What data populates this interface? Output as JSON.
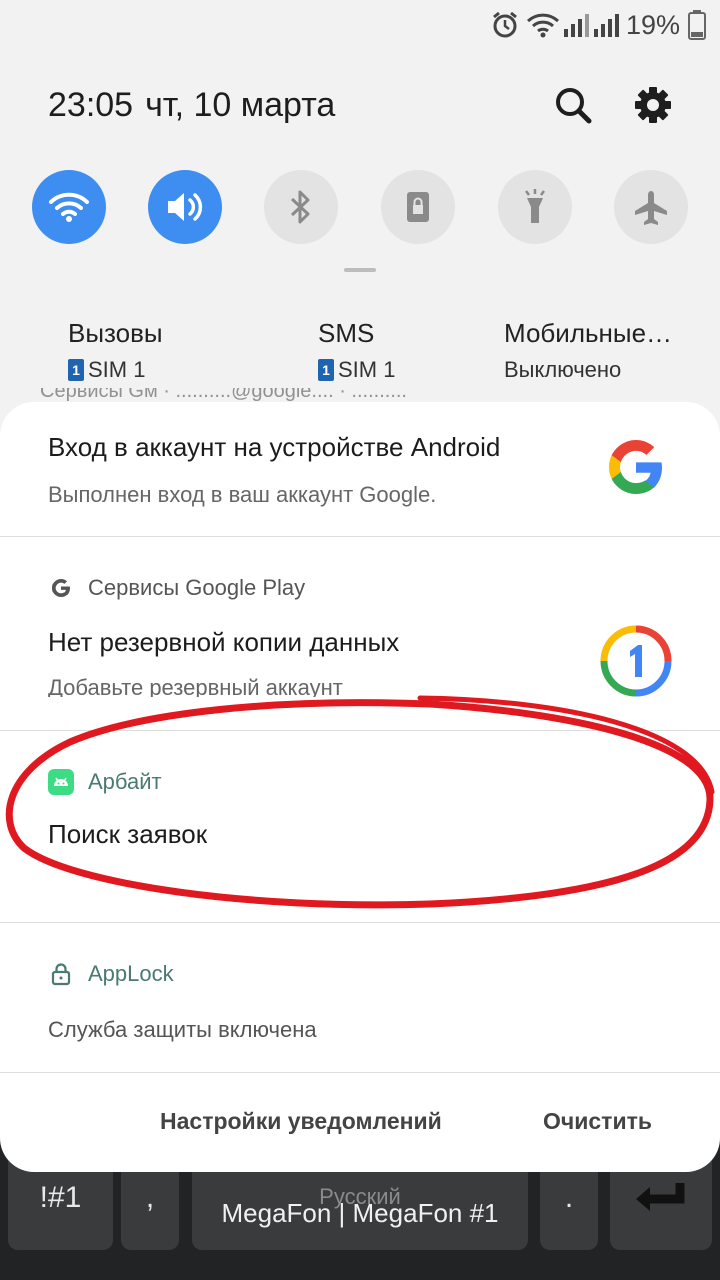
{
  "status_bar": {
    "battery_percent": "19%"
  },
  "header": {
    "time": "23:05",
    "date": "чт, 10 марта"
  },
  "quick_settings": [
    {
      "name": "wifi",
      "active": true
    },
    {
      "name": "sound",
      "active": true
    },
    {
      "name": "bluetooth",
      "active": false
    },
    {
      "name": "rotation-lock",
      "active": false
    },
    {
      "name": "flashlight",
      "active": false
    },
    {
      "name": "airplane",
      "active": false
    }
  ],
  "sim_settings": [
    {
      "title": "Вызовы",
      "sim_badge": "1",
      "sub": "SIM 1"
    },
    {
      "title": "SMS",
      "sim_badge": "1",
      "sub": "SIM 1"
    },
    {
      "title": "Мобильные…",
      "sub": "Выключено"
    }
  ],
  "ghost_row": "Сервисы Gм    ·    ..........@google....    ·    ..........",
  "notifications": [
    {
      "title": "Вход в аккаунт на устройстве Android",
      "body": "Выполнен вход в ваш аккаунт Google.",
      "icon": "google-g-icon"
    },
    {
      "app": "Сервисы Google Play",
      "title": "Нет резервной копии данных",
      "body": "Добавьте резервный аккаунт",
      "icon": "google-one-icon"
    },
    {
      "app": "Арбайт",
      "title": "Поиск заявок",
      "app_icon": "android-icon"
    },
    {
      "app": "AppLock",
      "body": "Служба защиты включена",
      "app_icon": "lock-icon"
    }
  ],
  "footer": {
    "settings_label": "Настройки уведомлений",
    "clear_label": "Очистить"
  },
  "keyboard": {
    "key_symbols": "!#1",
    "key_comma": ",",
    "key_space": "Русский",
    "key_period": ".",
    "carrier": "MegaFon | MegaFon #1"
  },
  "colors": {
    "accent": "#3d8ef0",
    "annotation": "#e0181f"
  }
}
